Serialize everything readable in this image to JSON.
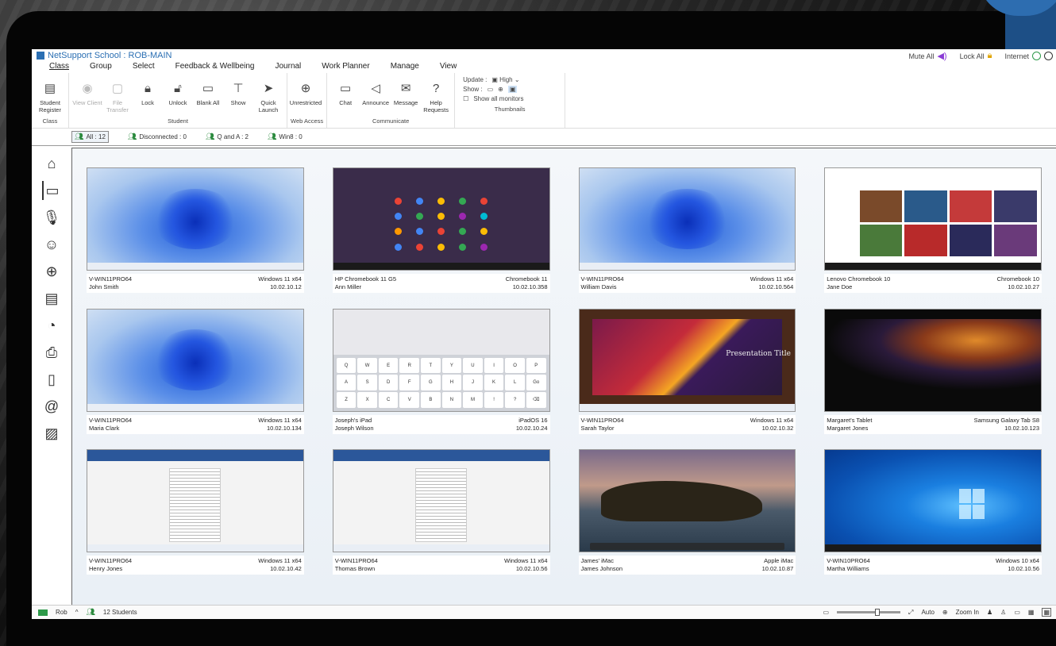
{
  "app": {
    "title": "NetSupport School : ROB-MAIN",
    "mute_all": "Mute All",
    "lock_all": "Lock All",
    "internet": "Internet"
  },
  "menu": [
    "Class",
    "Group",
    "Select",
    "Feedback & Wellbeing",
    "Journal",
    "Work Planner",
    "Manage",
    "View"
  ],
  "ribbon": {
    "class_group": {
      "label": "Class",
      "buttons": [
        {
          "label": "Student Register",
          "icon": "register-icon"
        }
      ]
    },
    "student_group": {
      "label": "Student",
      "buttons": [
        {
          "label": "View Client",
          "icon": "eye-icon",
          "disabled": true
        },
        {
          "label": "File Transfer",
          "icon": "folder-icon",
          "disabled": true
        },
        {
          "label": "Lock",
          "icon": "lock-icon"
        },
        {
          "label": "Unlock",
          "icon": "unlock-icon"
        },
        {
          "label": "Blank All",
          "icon": "monitor-icon"
        },
        {
          "label": "Show",
          "icon": "show-icon"
        },
        {
          "label": "Quick Launch",
          "icon": "send-icon"
        }
      ]
    },
    "web_group": {
      "label": "Web Access",
      "buttons": [
        {
          "label": "Unrestricted",
          "icon": "globe-icon"
        }
      ]
    },
    "communicate_group": {
      "label": "Communicate",
      "buttons": [
        {
          "label": "Chat",
          "icon": "chat-icon"
        },
        {
          "label": "Announce",
          "icon": "megaphone-icon"
        },
        {
          "label": "Message",
          "icon": "message-icon"
        },
        {
          "label": "Help Requests",
          "icon": "help-icon"
        }
      ]
    },
    "thumbnails_group": {
      "label": "Thumbnails",
      "update_label": "Update :",
      "update_value": "High",
      "show_label": "Show :",
      "show_all_monitors": "Show all monitors"
    }
  },
  "tabs": [
    {
      "label": "All : 12",
      "selected": true
    },
    {
      "label": "Disconnected : 0"
    },
    {
      "label": "Q and A : 2"
    },
    {
      "label": "Win8 : 0"
    }
  ],
  "sidebar_icons": [
    "home-icon",
    "monitor-icon",
    "microphone-icon",
    "wellbeing-icon",
    "globe-icon",
    "window-icon",
    "pie-chart-icon",
    "printer-icon",
    "device-icon",
    "at-icon",
    "image-icon"
  ],
  "students": [
    {
      "machine": "V-WIN11PRO64",
      "os": "Windows 11 x64",
      "name": "John Smith",
      "ip": "10.02.10.12",
      "screen": "win11"
    },
    {
      "machine": "HP Chromebook 11 G5",
      "os": "Chromebook 11",
      "name": "Ann Miller",
      "ip": "10.02.10.358",
      "screen": "chrome"
    },
    {
      "machine": "V-WIN11PRO64",
      "os": "Windows 11 x64",
      "name": "William Davis",
      "ip": "10.02.10.564",
      "screen": "win11"
    },
    {
      "machine": "Lenovo Chromebook 10",
      "os": "Chromebook 10",
      "name": "Jane Doe",
      "ip": "10.02.10.27",
      "screen": "youtube"
    },
    {
      "machine": "V-WIN11PRO64",
      "os": "Windows 11 x64",
      "name": "Maria Clark",
      "ip": "10.02.10.134",
      "screen": "win11"
    },
    {
      "machine": "Joseph's iPad",
      "os": "iPadOS 16",
      "name": "Joseph Wilson",
      "ip": "10.02.10.24",
      "screen": "ipad"
    },
    {
      "machine": "V-WIN11PRO64",
      "os": "Windows 11 x64",
      "name": "Sarah Taylor",
      "ip": "10.02.10.32",
      "screen": "ppt"
    },
    {
      "machine": "Margaret's Tablet",
      "os": "Samsung Galaxy Tab S8",
      "name": "Margaret Jones",
      "ip": "10.02.10.123",
      "screen": "samsung"
    },
    {
      "machine": "V-WIN11PRO64",
      "os": "Windows 11 x64",
      "name": "Henry Jones",
      "ip": "10.02.10.42",
      "screen": "word"
    },
    {
      "machine": "V-WIN11PRO64",
      "os": "Windows 11 x64",
      "name": "Thomas Brown",
      "ip": "10.02.10.56",
      "screen": "word"
    },
    {
      "machine": "James' iMac",
      "os": "Apple iMac",
      "name": "James Johnson",
      "ip": "10.02.10.87",
      "screen": "mac"
    },
    {
      "machine": "V-WIN10PRO64",
      "os": "Windows 10 x64",
      "name": "Martha Williams",
      "ip": "10.02.10.56",
      "screen": "win10"
    }
  ],
  "ppt_title": "Presentation Title",
  "ipad_keys": [
    "Q",
    "W",
    "E",
    "R",
    "T",
    "Y",
    "U",
    "I",
    "O",
    "P",
    "A",
    "S",
    "D",
    "F",
    "G",
    "H",
    "J",
    "K",
    "L",
    "Go",
    "Z",
    "X",
    "C",
    "V",
    "B",
    "N",
    "M",
    "!",
    "?",
    "⌫"
  ],
  "status": {
    "room": "Rob",
    "students": "12 Students",
    "auto": "Auto",
    "zoom": "Zoom In"
  },
  "colors": {
    "accent": "#2b6fb3",
    "status_green": "#2e9a4a",
    "deco_blue": "#1d4f86"
  }
}
